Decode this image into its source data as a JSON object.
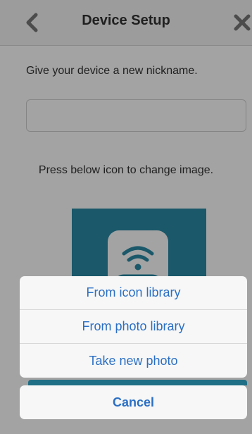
{
  "header": {
    "title": "Device Setup",
    "back_icon": "chevron-left-icon",
    "close_icon": "close-icon"
  },
  "form": {
    "nickname_prompt": "Give your device a new nickname.",
    "nickname_value": "",
    "change_image_prompt": "Press below icon to change image."
  },
  "device_image": {
    "icon": "wifi-device-icon",
    "tile_color": "#2a8aa6"
  },
  "action_sheet": {
    "options": [
      {
        "label": "From icon library"
      },
      {
        "label": "From photo library"
      },
      {
        "label": "Take new photo"
      }
    ],
    "cancel_label": "Cancel"
  },
  "colors": {
    "accent": "#2b6fc4",
    "overlay": "rgba(0,0,0,0.36)"
  }
}
